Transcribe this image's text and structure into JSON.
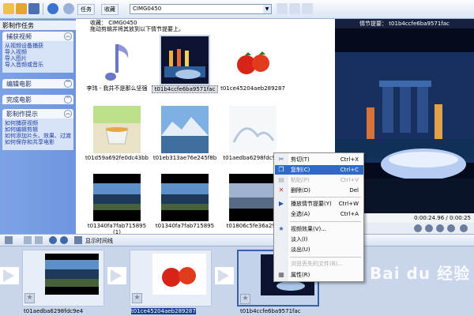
{
  "toolbar": {
    "tasks_label": "任务",
    "collections_label": "收藏",
    "collection_value": "CIMG0450"
  },
  "taskpane": {
    "title": "影制作任务",
    "sections": [
      {
        "title": "捕获视频",
        "links": [
          "从视频设备捕获",
          "导入视频",
          "导入图片",
          "导入音频或音乐"
        ]
      },
      {
        "title": "编辑电影",
        "links": []
      },
      {
        "title": "完成电影",
        "links": []
      },
      {
        "title": "影制作提示",
        "links": [
          "如何捕获视频",
          "如何编辑剪辑",
          "如何添加片头、效果、过渡",
          "如何保存和共享电影"
        ]
      }
    ]
  },
  "collection": {
    "title": "收藏： CIMG0450",
    "hint": "拖动剪辑并将其放到以下情节提要上。",
    "clips": [
      {
        "label": "李玮 - 我并不是那么坚强"
      },
      {
        "label": "t01b4ccfe6ba9571fac"
      },
      {
        "label": "t01ce45204aeb289287"
      },
      {
        "label": "t01d59a692fe0dc43bb"
      },
      {
        "label": "t01eb313ae76e245f8b"
      },
      {
        "label": "t01aedba6298fdc9e4"
      },
      {
        "label": "t01340fa7fab715895 (1)"
      },
      {
        "label": "t01340fa7fab715895"
      },
      {
        "label": "t01806c5fe36a294"
      }
    ]
  },
  "monitor": {
    "title": "情节提要： t01b4ccfe6ba9571fac",
    "time": "0:00:24.96 / 0:00:25"
  },
  "storyboard": {
    "show_timeline_label": "显示时间线",
    "items": [
      {
        "label": "t01aedba6298fdc9e4"
      },
      {
        "label": "t01ce45204aeb289287"
      },
      {
        "label": "t01b4ccfe6ba9571fac"
      }
    ]
  },
  "context_menu": {
    "items": [
      {
        "label": "剪切(T)",
        "shortcut": "Ctrl+X",
        "icon": "scissors-icon",
        "state": "normal"
      },
      {
        "label": "复制(C)",
        "shortcut": "Ctrl+C",
        "icon": "copy-icon",
        "state": "highlight"
      },
      {
        "label": "粘贴(P)",
        "shortcut": "Ctrl+V",
        "icon": "paste-icon",
        "state": "disabled"
      },
      {
        "label": "删除(D)",
        "shortcut": "Del",
        "icon": "delete-icon",
        "state": "normal"
      },
      {
        "label": "播放情节提要(Y)",
        "shortcut": "Ctrl+W",
        "icon": "play-icon",
        "state": "normal"
      },
      {
        "label": "全选(A)",
        "shortcut": "Ctrl+A",
        "icon": "",
        "state": "normal"
      },
      {
        "label": "视频效果(V)...",
        "shortcut": "",
        "icon": "star-icon",
        "state": "normal"
      },
      {
        "label": "淡入(I)",
        "shortcut": "",
        "icon": "",
        "state": "normal"
      },
      {
        "label": "淡出(U)",
        "shortcut": "",
        "icon": "",
        "state": "normal"
      },
      {
        "label": "浏览丢失的文件(B)...",
        "shortcut": "",
        "icon": "",
        "state": "disabled"
      },
      {
        "label": "属性(R)",
        "shortcut": "",
        "icon": "properties-icon",
        "state": "normal"
      }
    ]
  },
  "watermark": "Bai du 经验"
}
